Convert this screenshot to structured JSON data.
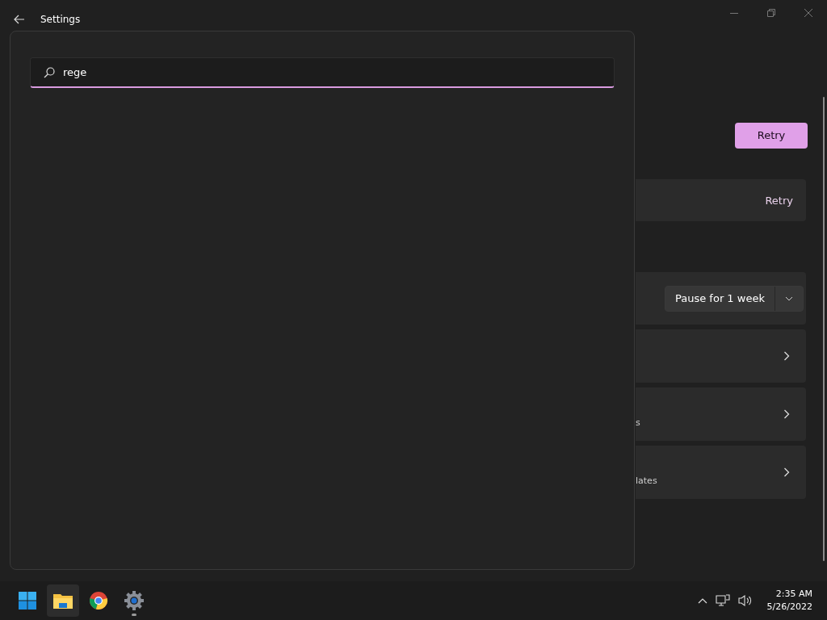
{
  "window": {
    "title": "Settings"
  },
  "search": {
    "value": "rege"
  },
  "primary_button": "Retry",
  "cards": [
    {
      "kind": "action",
      "action": "Retry"
    },
    {
      "kind": "dropdown",
      "value": "Pause for 1 week"
    },
    {
      "kind": "link"
    },
    {
      "kind": "link",
      "subtitle": "s"
    },
    {
      "kind": "link",
      "subtitle": "lates"
    }
  ],
  "taskbar": {
    "apps": [
      {
        "kind": "start",
        "selected": false,
        "running": false
      },
      {
        "kind": "explorer",
        "selected": true,
        "running": false
      },
      {
        "kind": "browser",
        "selected": false,
        "running": false
      },
      {
        "kind": "settings",
        "selected": false,
        "running": true
      }
    ],
    "clock": {
      "time": "2:35 AM",
      "date": "5/26/2022"
    }
  }
}
